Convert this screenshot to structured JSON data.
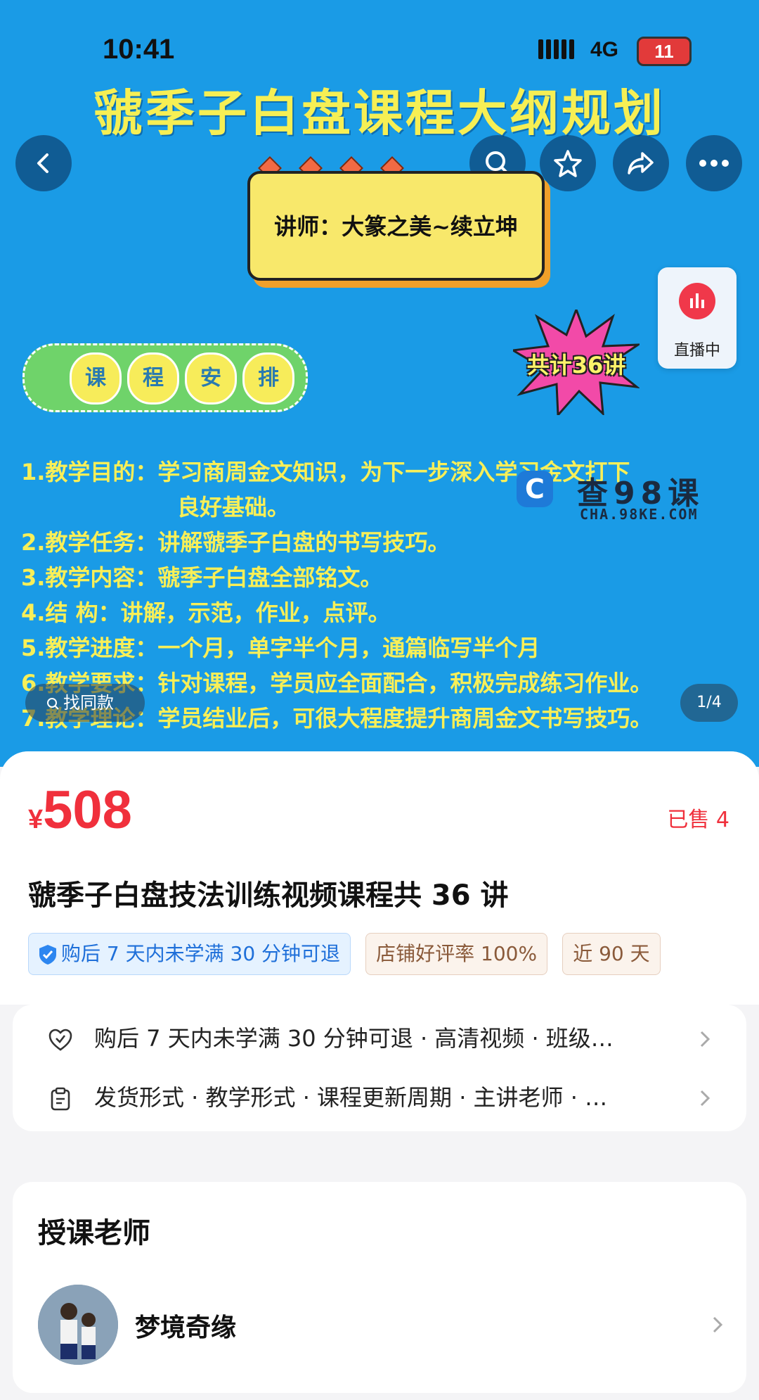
{
  "status_bar": {
    "time": "10:41",
    "network": "4G",
    "battery": "11"
  },
  "hero": {
    "title": "虢季子白盘课程大纲规划",
    "teacher_card": "讲师：大篆之美~续立坤",
    "live_label": "直播中",
    "schedule_chars": [
      "课",
      "程",
      "安",
      "排"
    ],
    "total_badge": "共计36讲",
    "outline": [
      "1.教学目的：学习商周金文知识，为下一步深入学习金文打下",
      "良好基础。",
      "2.教学任务：讲解虢季子白盘的书写技巧。",
      "3.教学内容：虢季子白盘全部铭文。",
      "4.结  构：讲解，示范，作业，点评。",
      "5.教学进度：一个月，单字半个月，通篇临写半个月",
      "6.教学要求：针对课程，学员应全面配合，积极完成练习作业。",
      "7.教学理论：学员结业后，可很大程度提升商周金文书写技巧。"
    ],
    "watermark_big": "查98课",
    "watermark_small": "CHA.98KE.COM",
    "find_similar": "找同款",
    "image_counter": "1/4"
  },
  "product": {
    "currency": "¥",
    "price": "508",
    "sold": "已售 4",
    "title": "虢季子白盘技法训练视频课程共 36 讲",
    "tags": [
      "购后 7 天内未学满 30 分钟可退",
      "店铺好评率 100%",
      "近 90 天"
    ]
  },
  "info_rows": [
    {
      "icon": "heart-shield-icon",
      "text": "购后 7 天内未学满 30 分钟可退 · 高清视频 · 班级…"
    },
    {
      "icon": "clipboard-icon",
      "text": "发货形式 · 教学形式 · 课程更新周期 · 主讲老师 · …"
    }
  ],
  "teacher_section": {
    "title": "授课老师",
    "name": "梦境奇缘"
  },
  "colors": {
    "hero_bg": "#1a9be6",
    "price_red": "#f0303c",
    "tag_blue": "#1e6fd9"
  }
}
